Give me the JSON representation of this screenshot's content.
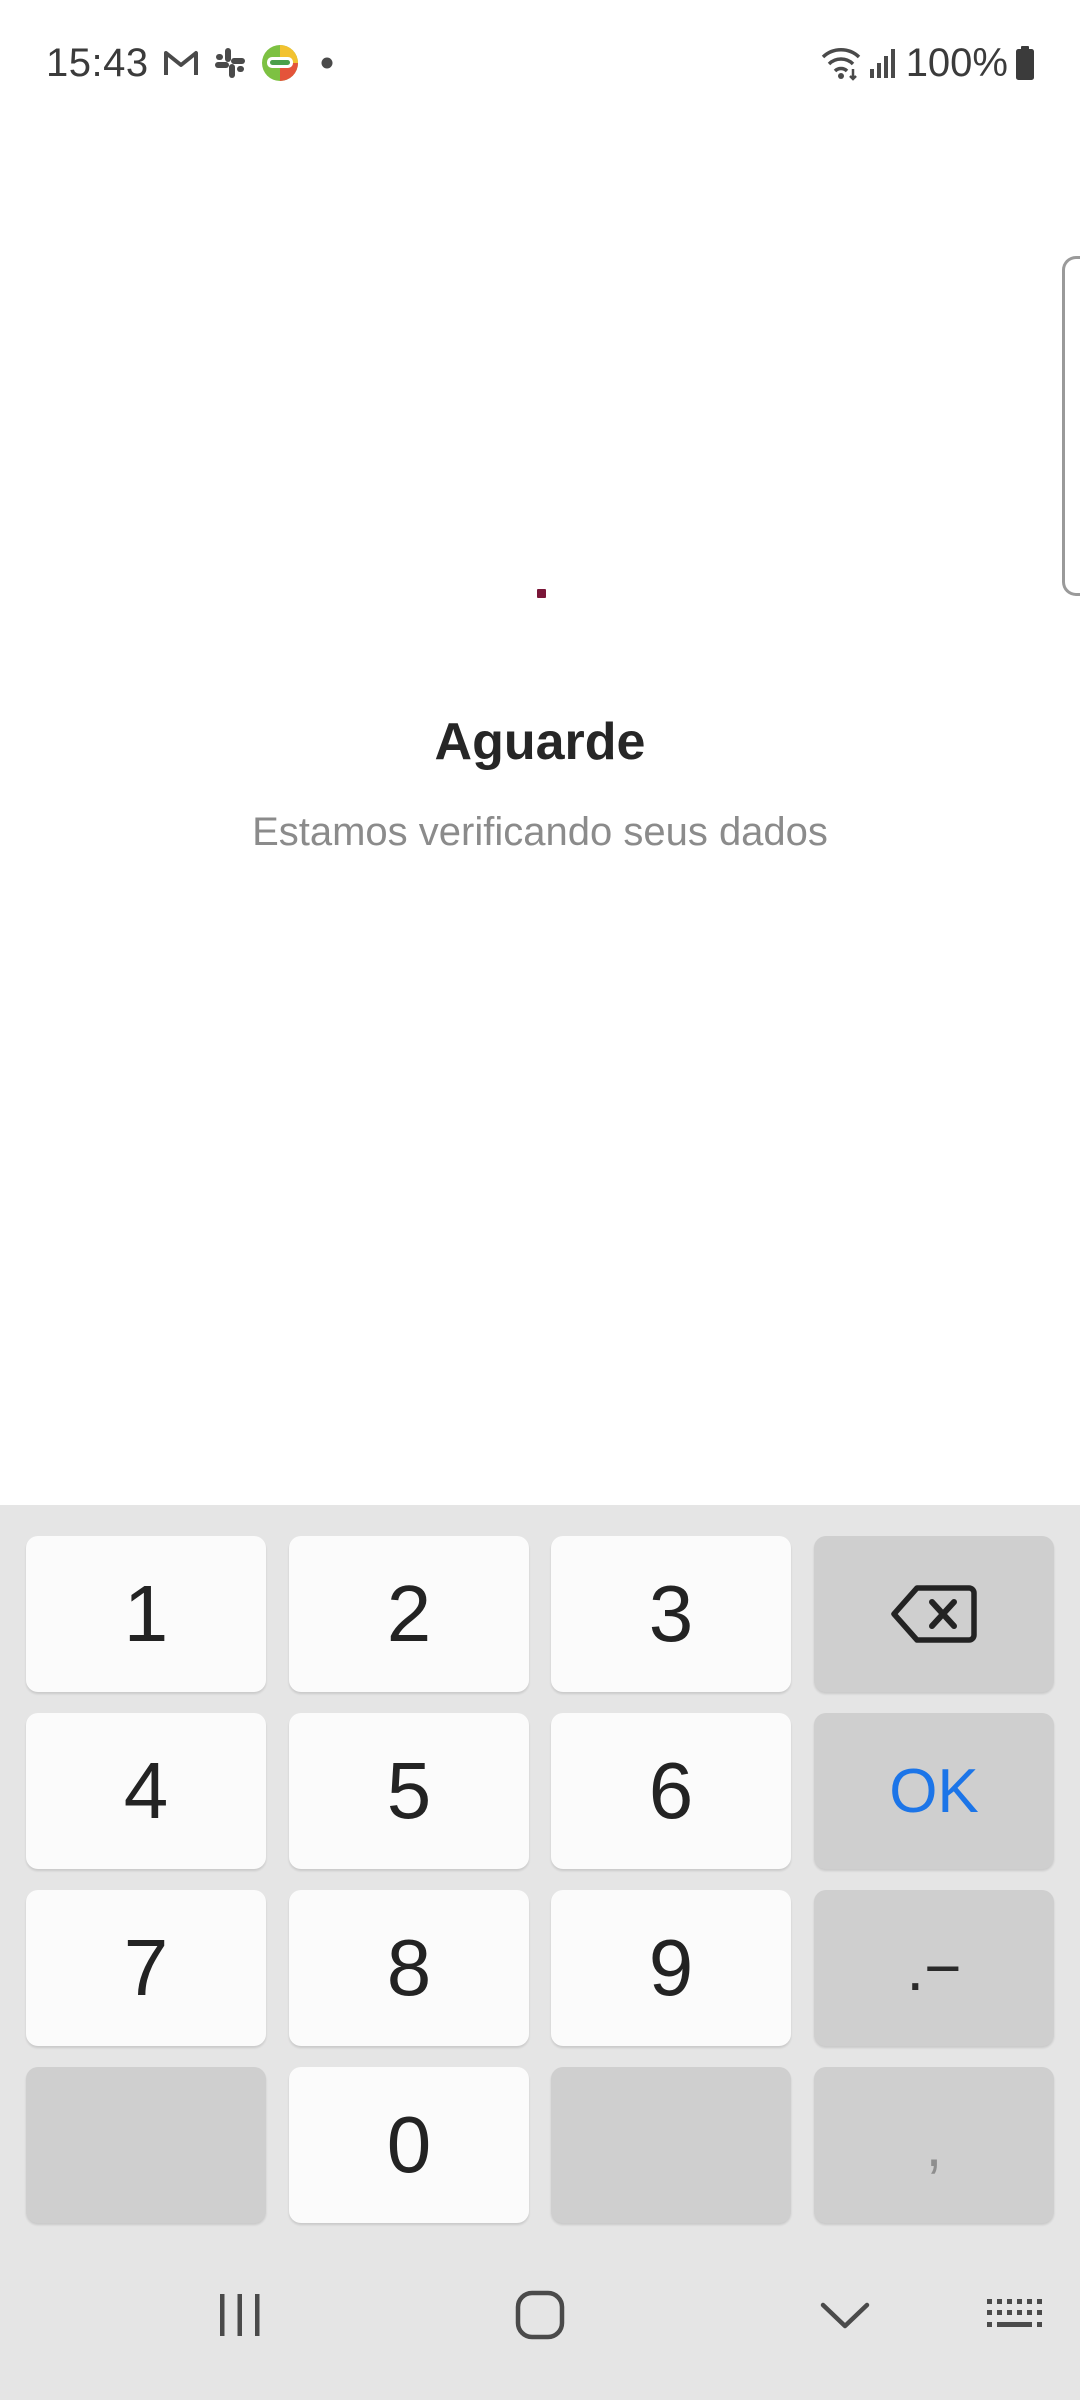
{
  "status_bar": {
    "time": "15:43",
    "battery": "100%",
    "icons_left": [
      "gmail-icon",
      "slack-icon",
      "aleloapp-icon",
      "notification-dot-icon"
    ],
    "icons_right": [
      "wifi-icon",
      "signal-icon",
      "battery-icon"
    ]
  },
  "loading": {
    "title": "Aguarde",
    "subtitle": "Estamos verificando seus dados",
    "accent_color": "#7a1638"
  },
  "keyboard": {
    "keys": {
      "k1": "1",
      "k2": "2",
      "k3": "3",
      "k4": "4",
      "k5": "5",
      "k6": "6",
      "k7": "7",
      "k8": "8",
      "k9": "9",
      "k0": "0",
      "ok": "OK",
      "dot_dash": ".−",
      "comma": ","
    },
    "backspace_icon": "backspace-icon",
    "ok_color": "#1c75e8"
  },
  "nav_bar": {
    "icons": [
      "recents-icon",
      "home-icon",
      "hide-keyboard-icon",
      "keyboard-switch-icon"
    ]
  }
}
